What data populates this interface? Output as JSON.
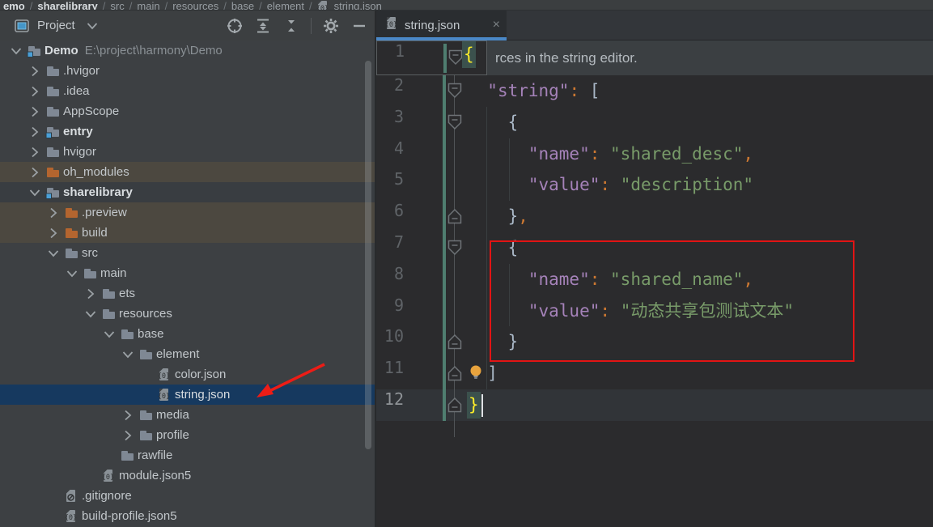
{
  "breadcrumb": {
    "segments": [
      {
        "text": "emo",
        "bold": true
      },
      {
        "text": "sharelibrary",
        "bold": true
      },
      {
        "text": "src"
      },
      {
        "text": "main"
      },
      {
        "text": "resources"
      },
      {
        "text": "base"
      },
      {
        "text": "element"
      },
      {
        "text": "string.json",
        "icon": "json"
      }
    ]
  },
  "project_panel": {
    "title": "Project",
    "toolbar_icons": [
      "locate",
      "expand-all",
      "collapse-all",
      "separator",
      "settings",
      "hide-panel"
    ]
  },
  "tree": {
    "root_path_suffix": "E:\\project\\harmony\\Demo",
    "selected_item": "string.json",
    "items": [
      {
        "label": "Demo",
        "suffix": "E:\\project\\harmony\\Demo",
        "level": 0,
        "icon": "module",
        "chev": "down",
        "bold": true
      },
      {
        "label": ".hvigor",
        "level": 1,
        "icon": "folder",
        "chev": "right"
      },
      {
        "label": ".idea",
        "level": 1,
        "icon": "folder",
        "chev": "right"
      },
      {
        "label": "AppScope",
        "level": 1,
        "icon": "folder",
        "chev": "right"
      },
      {
        "label": "entry",
        "level": 1,
        "icon": "module",
        "chev": "right",
        "bold": true
      },
      {
        "label": "hvigor",
        "level": 1,
        "icon": "folder",
        "chev": "right"
      },
      {
        "label": "oh_modules",
        "level": 1,
        "icon": "folder-excluded",
        "chev": "right",
        "hl": "brown"
      },
      {
        "label": "sharelibrary",
        "level": 1,
        "icon": "module",
        "chev": "down",
        "bold": true,
        "hl": "gray"
      },
      {
        "label": ".preview",
        "level": 2,
        "icon": "folder-excluded",
        "chev": "right",
        "hl": "brown"
      },
      {
        "label": "build",
        "level": 2,
        "icon": "folder-excluded",
        "chev": "right",
        "hl": "brown"
      },
      {
        "label": "src",
        "level": 2,
        "icon": "folder",
        "chev": "down"
      },
      {
        "label": "main",
        "level": 3,
        "icon": "folder",
        "chev": "down"
      },
      {
        "label": "ets",
        "level": 4,
        "icon": "folder",
        "chev": "right"
      },
      {
        "label": "resources",
        "level": 4,
        "icon": "folder",
        "chev": "down"
      },
      {
        "label": "base",
        "level": 5,
        "icon": "folder",
        "chev": "down"
      },
      {
        "label": "element",
        "level": 6,
        "icon": "folder",
        "chev": "down"
      },
      {
        "label": "color.json",
        "level": 7,
        "icon": "json"
      },
      {
        "label": "string.json",
        "level": 7,
        "icon": "json",
        "hl": "selected"
      },
      {
        "label": "media",
        "level": 6,
        "icon": "folder",
        "chev": "right"
      },
      {
        "label": "profile",
        "level": 6,
        "icon": "folder",
        "chev": "right"
      },
      {
        "label": "rawfile",
        "level": 5,
        "icon": "folder"
      },
      {
        "label": "module.json5",
        "level": 4,
        "icon": "json"
      },
      {
        "label": ".gitignore",
        "level": 2,
        "icon": "gitignore"
      },
      {
        "label": "build-profile.json5",
        "level": 2,
        "icon": "json"
      }
    ]
  },
  "editor": {
    "tab": {
      "label": "string.json",
      "close": "×",
      "active": true
    },
    "banner": {
      "text": "rces in the string editor."
    },
    "sticky_line": {
      "number": "1",
      "text": "{"
    },
    "code": {
      "language": "json",
      "lines": [
        {
          "num": "2",
          "fold": "open",
          "tokens": [
            [
              "ws",
              "  "
            ],
            [
              "key",
              "\"string\""
            ],
            [
              "op",
              ":"
            ],
            [
              "pl",
              " ["
            ]
          ]
        },
        {
          "num": "3",
          "fold": "open",
          "tokens": [
            [
              "pl",
              "    {"
            ]
          ]
        },
        {
          "num": "4",
          "tokens": [
            [
              "ws",
              "      "
            ],
            [
              "key",
              "\"name\""
            ],
            [
              "op",
              ":"
            ],
            [
              "pl",
              " "
            ],
            [
              "str",
              "\"shared_desc\""
            ],
            [
              "op",
              ","
            ]
          ]
        },
        {
          "num": "5",
          "tokens": [
            [
              "ws",
              "      "
            ],
            [
              "key",
              "\"value\""
            ],
            [
              "op",
              ":"
            ],
            [
              "pl",
              " "
            ],
            [
              "str",
              "\"description\""
            ]
          ]
        },
        {
          "num": "6",
          "fold": "close",
          "tokens": [
            [
              "pl",
              "    }"
            ],
            [
              "op",
              ","
            ]
          ]
        },
        {
          "num": "7",
          "fold": "open",
          "tokens": [
            [
              "pl",
              "    {"
            ]
          ]
        },
        {
          "num": "8",
          "tokens": [
            [
              "ws",
              "      "
            ],
            [
              "key",
              "\"name\""
            ],
            [
              "op",
              ":"
            ],
            [
              "pl",
              " "
            ],
            [
              "str",
              "\"shared_name\""
            ],
            [
              "op",
              ","
            ]
          ]
        },
        {
          "num": "9",
          "tokens": [
            [
              "ws",
              "      "
            ],
            [
              "key",
              "\"value\""
            ],
            [
              "op",
              ":"
            ],
            [
              "pl",
              " "
            ],
            [
              "str",
              "\"动态共享包测试文本\""
            ]
          ]
        },
        {
          "num": "10",
          "fold": "close",
          "tokens": [
            [
              "pl",
              "    }"
            ]
          ]
        },
        {
          "num": "11",
          "fold": "close",
          "bulb": true,
          "tokens": [
            [
              "ws",
              "  "
            ],
            [
              "pl",
              "]"
            ]
          ]
        },
        {
          "num": "12",
          "fold": "close",
          "current": true,
          "caret": true,
          "tokens": [
            [
              "match",
              "}"
            ]
          ]
        }
      ]
    }
  },
  "annotations": {
    "red_box_around_lines": "7-10",
    "arrow_points_to": "string.json tree item"
  },
  "colors": {
    "editor_bg": "#2B2B2D",
    "panel_bg": "#3D4043",
    "selection_blue": "#16395F",
    "excluded_row_brown": "#4C4840",
    "tab_underline_blue": "#4A88C7",
    "json_key_purple": "#A582B9",
    "json_string_green": "#789B69",
    "punctuation_orange": "#CC7832",
    "matched_brace_yellow": "#FFEF28",
    "matched_brace_bg": "#3B514D",
    "vcs_added_strip": "#4F7E70",
    "annotation_red": "#E21414"
  }
}
